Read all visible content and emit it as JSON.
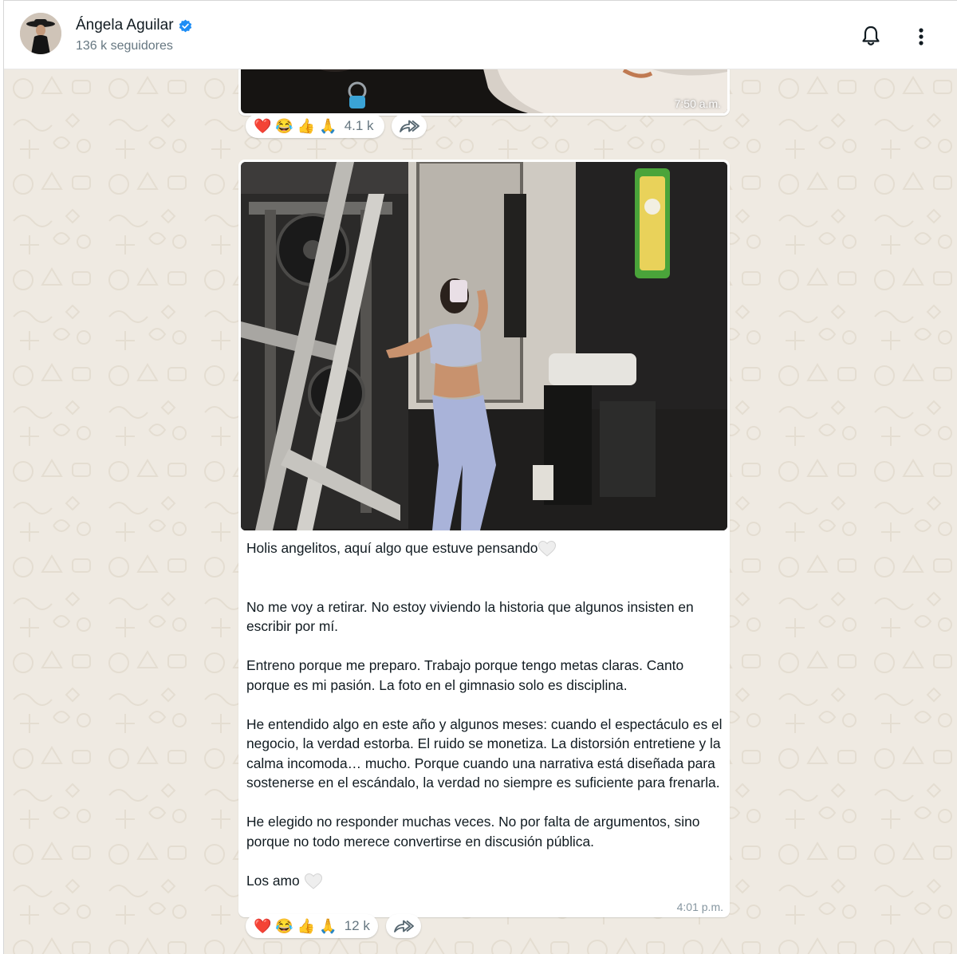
{
  "channel": {
    "name": "Ángela Aguilar",
    "followers": "136 k seguidores",
    "verified_color": "#1d8df5"
  },
  "header_icons": [
    "bell-icon",
    "kebab-menu-icon"
  ],
  "messages": [
    {
      "time": "7:50 a.m.",
      "reactions": {
        "emojis": [
          "❤️",
          "😂",
          "👍",
          "🙏"
        ],
        "count": "4.1 k"
      }
    },
    {
      "time": "4:01 p.m.",
      "text": {
        "line1": "Holis angelitos, aquí algo que estuve pensando",
        "p1": "No me voy a retirar. No estoy viviendo la historia que algunos insisten en escribir por mí.",
        "p2": "Entreno porque me preparo. Trabajo porque tengo metas claras. Canto porque es mi pasión. La foto en el gimnasio solo es disciplina.",
        "p3": "He entendido algo en este año y algunos meses: cuando el espectáculo es el negocio, la verdad estorba. El ruido se monetiza. La distorsión entretiene y la calma incomoda… mucho. Porque cuando una narrativa está diseñada para sostenerse en el escándalo, la verdad no siempre es suficiente para frenarla.",
        "p4": "He elegido no responder muchas veces. No por falta de argumentos, sino porque no todo merece convertirse en discusión pública.",
        "p5": "Los amo"
      },
      "reactions": {
        "emojis": [
          "❤️",
          "😂",
          "👍",
          "🙏"
        ],
        "count": "12 k"
      }
    }
  ],
  "colors": {
    "chat_bg": "#efeae2",
    "bubble": "#ffffff",
    "meta": "#8696a0"
  }
}
